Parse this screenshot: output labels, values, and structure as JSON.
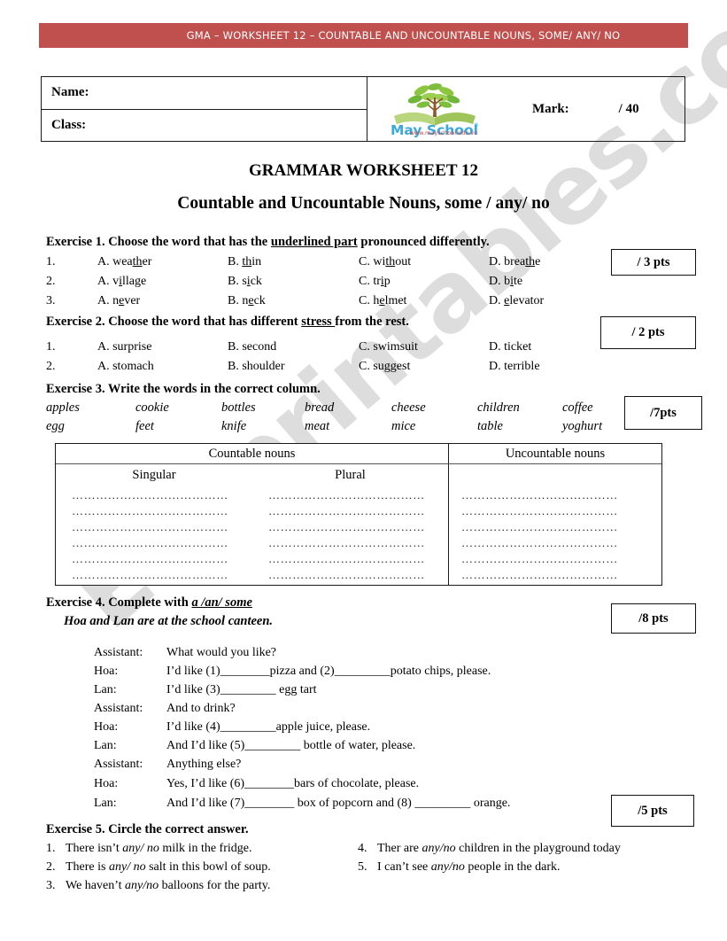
{
  "banner": {
    "text": "GMA – WORKSHEET 12 – COUNTABLE AND UNCOUNTABLE NOUNS, SOME/ ANY/ NO",
    "color": "#C0504D"
  },
  "header_table": {
    "name_label": "Name:",
    "class_label": "Class:",
    "mark_label": "Mark:",
    "mark_value": "/ 40",
    "logo": {
      "name": "May School",
      "url": "www.mayschool.edu.vn",
      "text_color": "#3BA9DC",
      "url_color": "#C0504D",
      "leaf_color": "#7CBF4A",
      "trunk_color": "#8B5A2B",
      "book_color": "#9FC55A",
      "registered_mark": "®"
    }
  },
  "titles": {
    "line1": "GRAMMAR WORKSHEET 12",
    "line2": "Countable and Uncountable Nouns, some / any/ no"
  },
  "watermark": {
    "text": "ESLprintables.com"
  },
  "exercise1": {
    "heading_prefix": "Exercise 1. Choose the word that has the ",
    "heading_underlined": "underlined part",
    "heading_suffix": " pronounced differently.",
    "points": "/ 3 pts",
    "rows": [
      {
        "num": "1.",
        "a_pre": "A. wea",
        "a_ul": "th",
        "a_post": "er",
        "b_pre": "B. ",
        "b_ul": "th",
        "b_post": "in",
        "c_pre": "C. wi",
        "c_ul": "th",
        "c_post": "out",
        "d_pre": "D. brea",
        "d_ul": "th",
        "d_post": "e"
      },
      {
        "num": "2.",
        "a_pre": "A. v",
        "a_ul": "i",
        "a_post": "llage",
        "b_pre": "B. s",
        "b_ul": "i",
        "b_post": "ck",
        "c_pre": "C.  tr",
        "c_ul": "i",
        "c_post": "p",
        "d_pre": "D.  b",
        "d_ul": "i",
        "d_post": "te"
      },
      {
        "num": "3.",
        "a_pre": "A. n",
        "a_ul": "e",
        "a_post": "ver",
        "b_pre": "B. n",
        "b_ul": "e",
        "b_post": "ck",
        "c_pre": "C. h",
        "c_ul": "e",
        "c_post": "lmet",
        "d_pre": "D. ",
        "d_ul": "e",
        "d_post": "levator"
      }
    ]
  },
  "exercise2": {
    "heading_prefix": "Exercise 2. Choose the word that has different ",
    "heading_underlined": "stress ",
    "heading_suffix": "from the rest.",
    "points": "/ 2 pts",
    "rows": [
      {
        "num": "1.",
        "a": "A. surprise",
        "b": "B. second",
        "c": "C. swimsuit",
        "d": "D. ticket"
      },
      {
        "num": "2.",
        "a": "A. stomach",
        "b": "B. shoulder",
        "c": "C. suggest",
        "d": " D. terrible"
      }
    ]
  },
  "exercise3": {
    "heading": "Exercise 3. Write the words in the correct column.",
    "points": "/7pts",
    "wordbank_row1": [
      "apples",
      "cookie",
      "bottles",
      "bread",
      "cheese",
      "children",
      "coffee"
    ],
    "wordbank_row2": [
      "egg",
      "feet",
      "knife",
      "meat",
      "mice",
      "table",
      "yoghurt"
    ],
    "table": {
      "countable_header": "Countable nouns",
      "uncountable_header": "Uncountable nouns",
      "singular_header": "Singular",
      "plural_header": "Plural",
      "blank_line": "…………………………………",
      "row_count": 6
    }
  },
  "exercise4": {
    "heading_prefix": "Exercise 4. Complete with ",
    "heading_underlined": "a /an/ some",
    "points": "/8 pts",
    "subtitle": "Hoa and Lan are at the school canteen.",
    "dialogue": [
      {
        "speaker": "Assistant:",
        "line": "What would you like?"
      },
      {
        "speaker": "Hoa:",
        "line": "I’d like (1)________pizza and (2)_________potato chips, please."
      },
      {
        "speaker": "Lan:",
        "line": "I’d like (3)_________ egg tart"
      },
      {
        "speaker": "Assistant:",
        "line": "And to drink?"
      },
      {
        "speaker": "Hoa:",
        "line": "I’d like (4)_________apple juice, please."
      },
      {
        "speaker": "Lan:",
        "line": "And I’d like (5)_________ bottle of water, please."
      },
      {
        "speaker": "Assistant:",
        "line": "Anything else?"
      },
      {
        "speaker": "Hoa:",
        "line": "Yes, I’d like (6)________bars of chocolate, please."
      },
      {
        "speaker": "Lan:",
        "line": "And I’d like (7)________ box of popcorn and (8) _________ orange."
      }
    ]
  },
  "exercise5": {
    "heading": "Exercise 5. Circle the correct answer.",
    "points": "/5 pts",
    "left_items": [
      {
        "num": "1.",
        "pre": "There isn’t ",
        "choice": "any/ no",
        "post": " milk in the fridge."
      },
      {
        "num": "2.",
        "pre": "There is ",
        "choice": "any/ no",
        "post": " salt in this bowl of soup."
      },
      {
        "num": "3.",
        "pre": "We haven’t ",
        "choice": "any/no",
        "post": " balloons for the party."
      }
    ],
    "right_items": [
      {
        "num": "4.",
        "pre": "Ther are ",
        "choice": "any/no",
        "post": " children in the playground today"
      },
      {
        "num": "5.",
        "pre": "I can’t see ",
        "choice": "any/no",
        "post": " people in the dark."
      }
    ]
  }
}
